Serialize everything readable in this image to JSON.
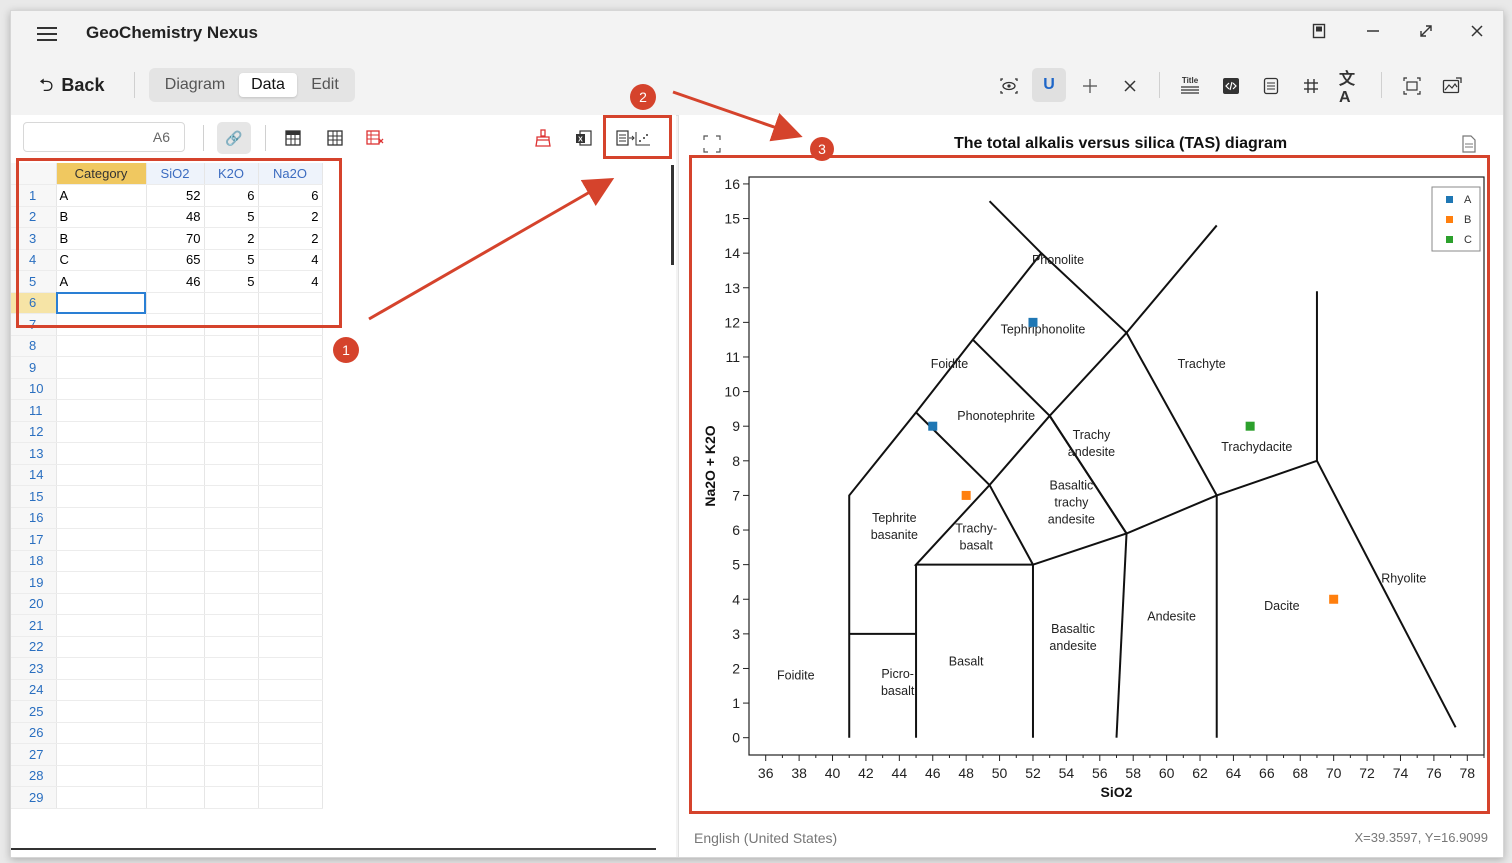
{
  "app": {
    "title": "GeoChemistry Nexus",
    "back_label": "Back",
    "tabs": [
      {
        "label": "Diagram",
        "active": false
      },
      {
        "label": "Data",
        "active": true
      },
      {
        "label": "Edit",
        "active": false
      }
    ]
  },
  "toolbar_icons": [
    "eye-icon",
    "magnet-icon",
    "crosshair-icon",
    "close-icon",
    "title-icon",
    "code-icon",
    "document-icon",
    "grid-icon",
    "translate-icon",
    "fit-icon",
    "export-icon"
  ],
  "title_icon_label": "Title",
  "spreadsheet": {
    "cell_ref": "A6",
    "columns": [
      "Category",
      "SiO2",
      "K2O",
      "Na2O"
    ],
    "rows": [
      [
        "A",
        "52",
        "6",
        "6"
      ],
      [
        "B",
        "48",
        "5",
        "2"
      ],
      [
        "B",
        "70",
        "2",
        "2"
      ],
      [
        "C",
        "65",
        "5",
        "4"
      ],
      [
        "A",
        "46",
        "5",
        "4"
      ]
    ],
    "row_numbers": [
      "1",
      "2",
      "3",
      "4",
      "5",
      "6",
      "7",
      "8",
      "9",
      "10",
      "11",
      "12",
      "13",
      "14",
      "15",
      "16",
      "17",
      "18",
      "19",
      "20",
      "21",
      "22",
      "23",
      "24",
      "25",
      "26",
      "27",
      "28",
      "29"
    ]
  },
  "annotations": {
    "badge1": "1",
    "badge2": "2",
    "badge3": "3"
  },
  "chart_data": {
    "type": "scatter",
    "title": "The total alkalis versus silica (TAS) diagram",
    "xlabel": "SiO2",
    "ylabel": "Na2O + K2O",
    "xlim": [
      35,
      79
    ],
    "ylim": [
      -0.5,
      16.2
    ],
    "xticks": [
      "36",
      "38",
      "40",
      "42",
      "44",
      "46",
      "48",
      "50",
      "52",
      "54",
      "56",
      "58",
      "60",
      "62",
      "64",
      "66",
      "68",
      "70",
      "72",
      "74",
      "76",
      "78"
    ],
    "yticks": [
      "0",
      "1",
      "2",
      "3",
      "4",
      "5",
      "6",
      "7",
      "8",
      "9",
      "10",
      "11",
      "12",
      "13",
      "14",
      "15",
      "16"
    ],
    "series": [
      {
        "name": "A",
        "color": "#1f77b4",
        "points": [
          [
            52,
            12
          ],
          [
            46,
            9
          ]
        ]
      },
      {
        "name": "B",
        "color": "#ff7f0e",
        "points": [
          [
            48,
            7
          ],
          [
            70,
            4
          ]
        ]
      },
      {
        "name": "C",
        "color": "#2ca02c",
        "points": [
          [
            65,
            9
          ]
        ]
      }
    ],
    "legend": "top-right",
    "fields": [
      "Foidite",
      "Phonolite",
      "Tephriphonolite",
      "Trachyte",
      "Phonotephrite",
      "Trachy andesite",
      "Trachydacite",
      "Basaltic trachy andesite",
      "Tephrite basanite",
      "Trachy- basalt",
      "Rhyolite",
      "Andesite",
      "Dacite",
      "Basaltic andesite",
      "Basalt",
      "Foidite",
      "Picro- basalt"
    ]
  },
  "status": {
    "language": "English (United States)",
    "coords": "X=39.3597, Y=16.9099"
  }
}
